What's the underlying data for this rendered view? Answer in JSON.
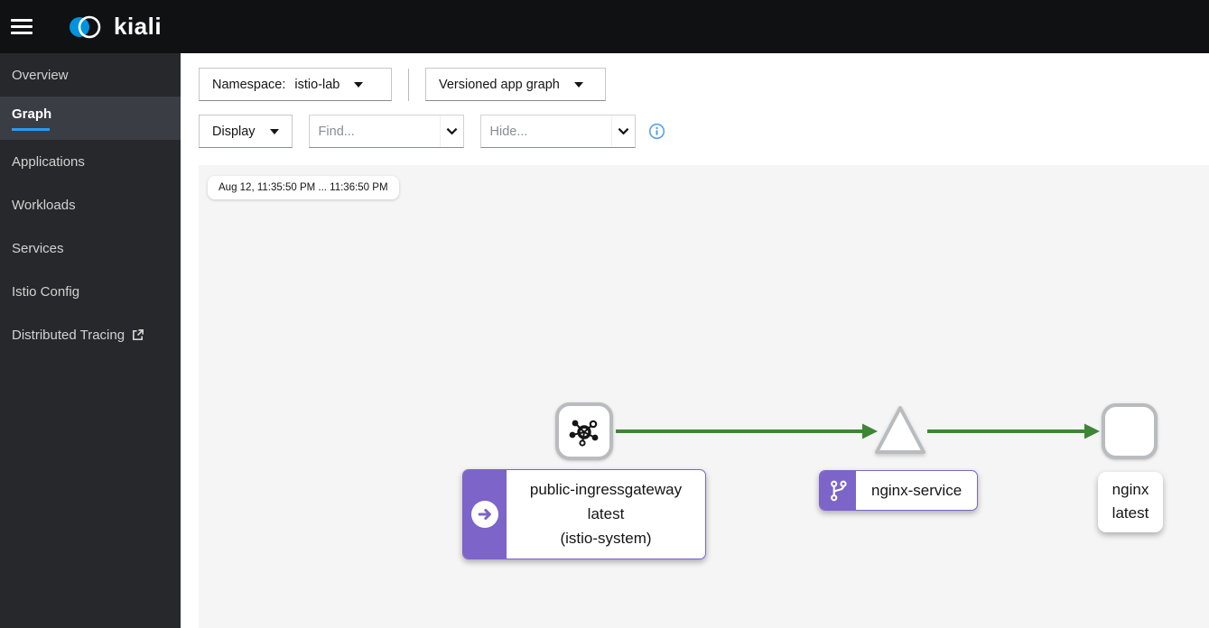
{
  "masthead": {
    "brand": "kiali"
  },
  "sidebar": {
    "items": [
      {
        "label": "Overview"
      },
      {
        "label": "Graph",
        "active": true
      },
      {
        "label": "Applications"
      },
      {
        "label": "Workloads"
      },
      {
        "label": "Services"
      },
      {
        "label": "Istio Config"
      },
      {
        "label": "Distributed Tracing",
        "external": true
      }
    ]
  },
  "toolbar": {
    "namespace_label": "Namespace:",
    "namespace_value": "istio-lab",
    "graph_type_value": "Versioned app graph",
    "display_label": "Display",
    "find_placeholder": "Find...",
    "hide_placeholder": "Hide..."
  },
  "graph": {
    "time_range": "Aug 12, 11:35:50 PM ... 11:36:50 PM",
    "nodes": [
      {
        "id": "public-ingressgateway",
        "shape": "rounded-square",
        "icon": "mesh-icon",
        "badge": "arrow-right-badge",
        "label_lines": [
          "public-ingressgateway",
          "latest",
          "(istio-system)"
        ]
      },
      {
        "id": "nginx-service",
        "shape": "triangle",
        "badge": "code-branch-badge",
        "label": "nginx-service"
      },
      {
        "id": "nginx",
        "shape": "rounded-square",
        "label_lines": [
          "nginx",
          "latest"
        ]
      }
    ],
    "edges": [
      {
        "from": "public-ingressgateway",
        "to": "nginx-service",
        "status": "healthy"
      },
      {
        "from": "nginx-service",
        "to": "nginx",
        "status": "healthy"
      }
    ]
  },
  "colors": {
    "masthead_bg": "#101113",
    "sidebar_bg": "#26282c",
    "sidebar_active_bg": "#3a3d43",
    "active_underline": "#2b9af3",
    "brand_blue": "#0093dd",
    "edge_healthy_green": "#3e8635",
    "node_purple": "#7c64c8",
    "node_border_gray": "#b9bcbf",
    "graph_bg": "#f5f5f5",
    "info_icon_blue": "#5ba3e6"
  }
}
